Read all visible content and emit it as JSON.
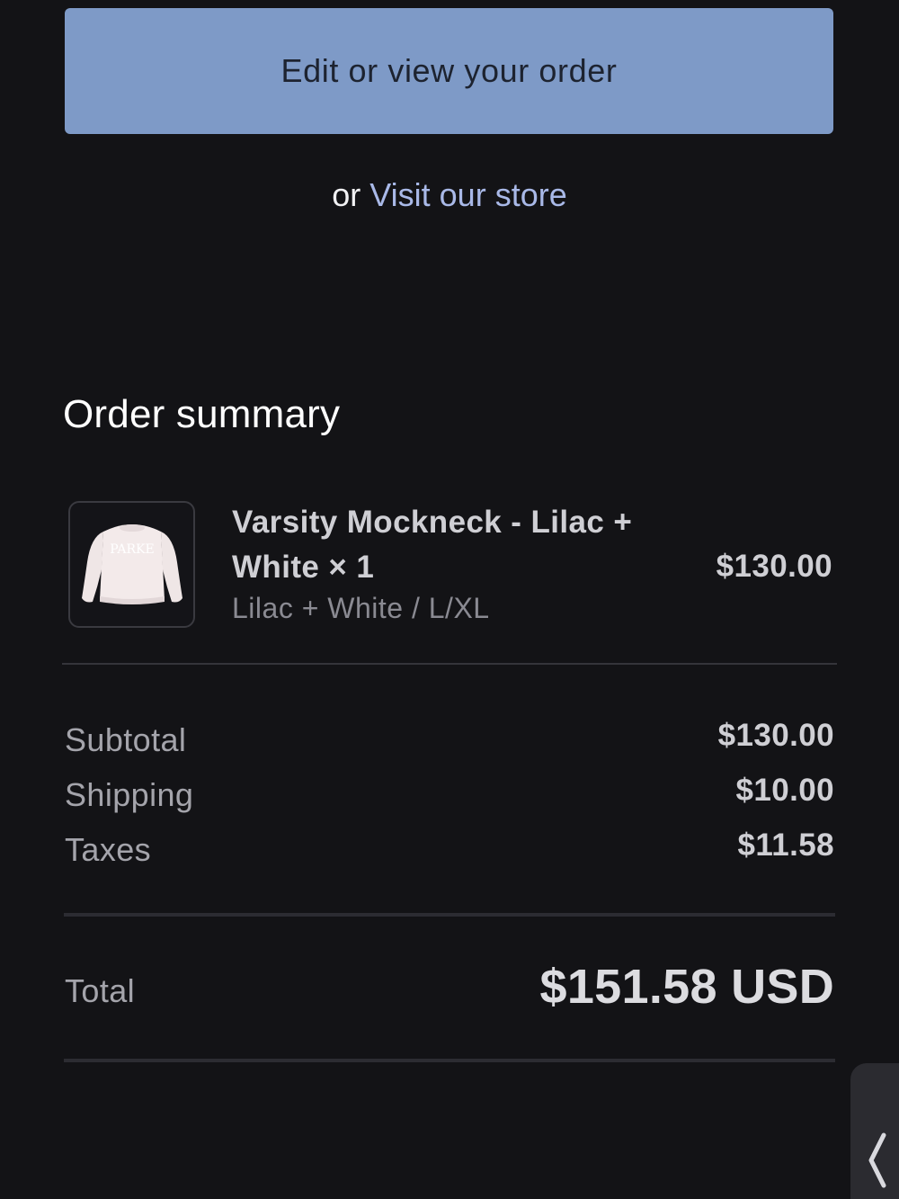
{
  "actions": {
    "edit_order_label": "Edit or view your order",
    "or_text": "or",
    "visit_store_label": "Visit our store"
  },
  "summary": {
    "title": "Order summary",
    "item": {
      "name": "Varsity Mockneck - Lilac + White × 1",
      "variant": "Lilac + White / L/XL",
      "price": "$130.00",
      "thumbnail_icon": "sweatshirt-icon",
      "thumbnail_print": "PARKE"
    },
    "subtotal_label": "Subtotal",
    "subtotal_value": "$130.00",
    "shipping_label": "Shipping",
    "shipping_value": "$10.00",
    "taxes_label": "Taxes",
    "taxes_value": "$11.58",
    "total_label": "Total",
    "total_value": "$151.58 USD"
  },
  "side_tab": {
    "icon": "chevron-left-icon",
    "glyph": "❬"
  },
  "colors": {
    "background": "#131316",
    "button": "#7e9ac7",
    "link": "#a9b9e8"
  }
}
